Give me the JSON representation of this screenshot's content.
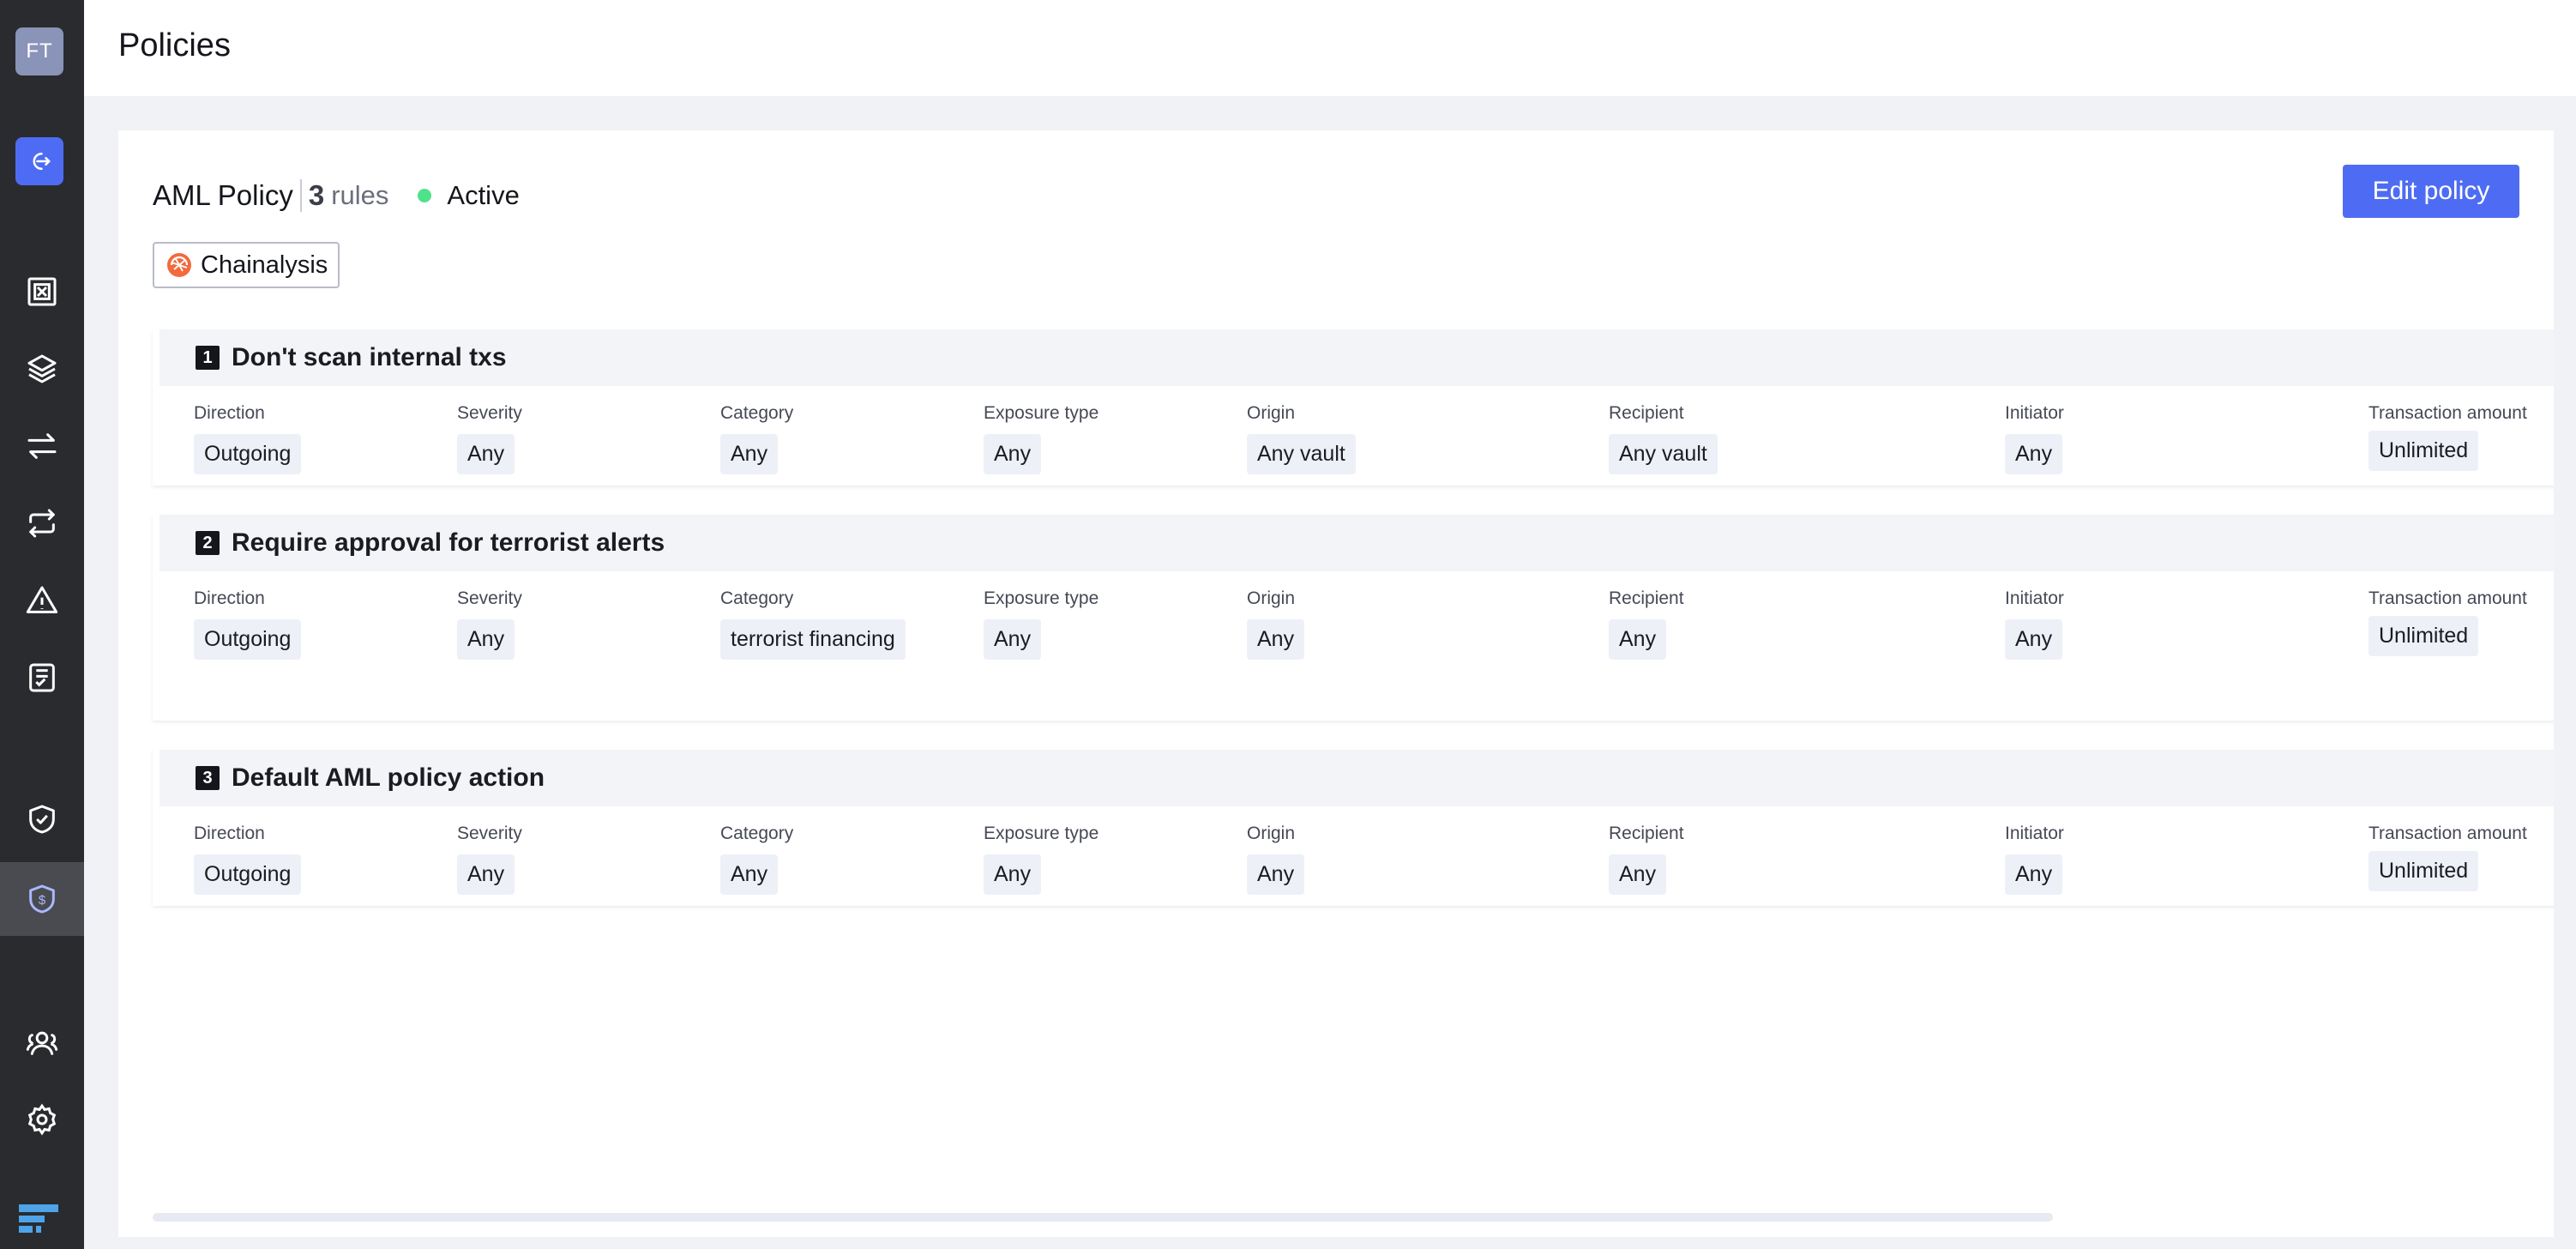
{
  "user": {
    "initials": "FT"
  },
  "header": {
    "title": "Policies"
  },
  "sidebar": {
    "icons": [
      "exit-icon",
      "vault-icon",
      "layers-icon",
      "transfer-icon",
      "swap-icon",
      "alert-icon",
      "ledger-icon",
      "shield-check-icon",
      "aml-shield-icon",
      "users-icon",
      "settings-icon"
    ],
    "active": "aml-shield-icon"
  },
  "policy": {
    "name": "AML Policy",
    "rule_count": "3",
    "rule_word": "rules",
    "status": "Active",
    "status_color": "#4fe28a",
    "edit_label": "Edit policy",
    "provider": "Chainalysis"
  },
  "columns": [
    "Direction",
    "Severity",
    "Category",
    "Exposure type",
    "Origin",
    "Recipient",
    "Initiator",
    "Transaction amount"
  ],
  "rules": [
    {
      "number": "1",
      "title": "Don't scan internal txs",
      "values": [
        "Outgoing",
        "Any",
        "Any",
        "Any",
        "Any vault",
        "Any vault",
        "Any",
        "Unlimited"
      ]
    },
    {
      "number": "2",
      "title": "Require approval for terrorist alerts",
      "values": [
        "Outgoing",
        "Any",
        "terrorist financing",
        "Any",
        "Any",
        "Any",
        "Any",
        "Unlimited"
      ]
    },
    {
      "number": "3",
      "title": "Default AML policy action",
      "values": [
        "Outgoing",
        "Any",
        "Any",
        "Any",
        "Any",
        "Any",
        "Any",
        "Unlimited"
      ]
    }
  ],
  "colors": {
    "accent": "#4e6cf3",
    "sidebar": "#2a2b2e"
  }
}
